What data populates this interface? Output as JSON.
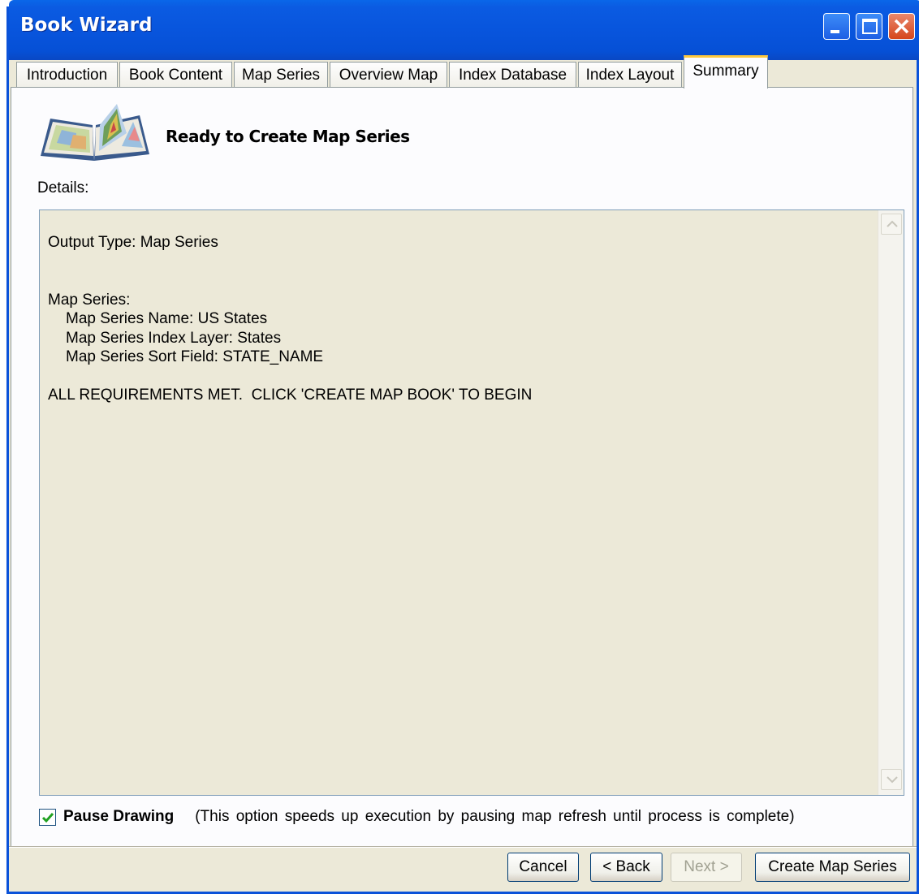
{
  "window": {
    "title": "Book Wizard"
  },
  "tabs": [
    {
      "label": "Introduction"
    },
    {
      "label": "Book Content"
    },
    {
      "label": "Map Series"
    },
    {
      "label": "Overview Map"
    },
    {
      "label": "Index Database"
    },
    {
      "label": "Index Layout"
    },
    {
      "label": "Summary",
      "active": true
    }
  ],
  "summary": {
    "heading": "Ready to Create Map Series",
    "details_label": "Details:",
    "details_lines": {
      "output_type": "Output Type: Map Series",
      "map_series_header": "Map Series:",
      "series_name": "Map Series Name: US States",
      "index_layer": "Map Series Index Layer: States",
      "sort_field": "Map Series Sort Field: STATE_NAME",
      "status": "ALL REQUIREMENTS MET.  CLICK 'CREATE MAP BOOK' TO BEGIN"
    },
    "pause_drawing": {
      "checked": true,
      "label": "Pause Drawing",
      "hint": "(This option speeds up execution by pausing map refresh until process is complete)"
    }
  },
  "buttons": {
    "cancel": "Cancel",
    "back": "< Back",
    "next": "Next >",
    "create": "Create Map Series"
  },
  "colors": {
    "titlebar": "#0855DD",
    "dialog_bg": "#ECE9D8",
    "active_tab_accent": "#FFC83C",
    "close_button": "#D5461C"
  },
  "icons": [
    "book-map-icon",
    "minimize-icon",
    "maximize-icon",
    "close-icon",
    "scroll-up-icon",
    "scroll-down-icon",
    "checkmark-icon"
  ]
}
